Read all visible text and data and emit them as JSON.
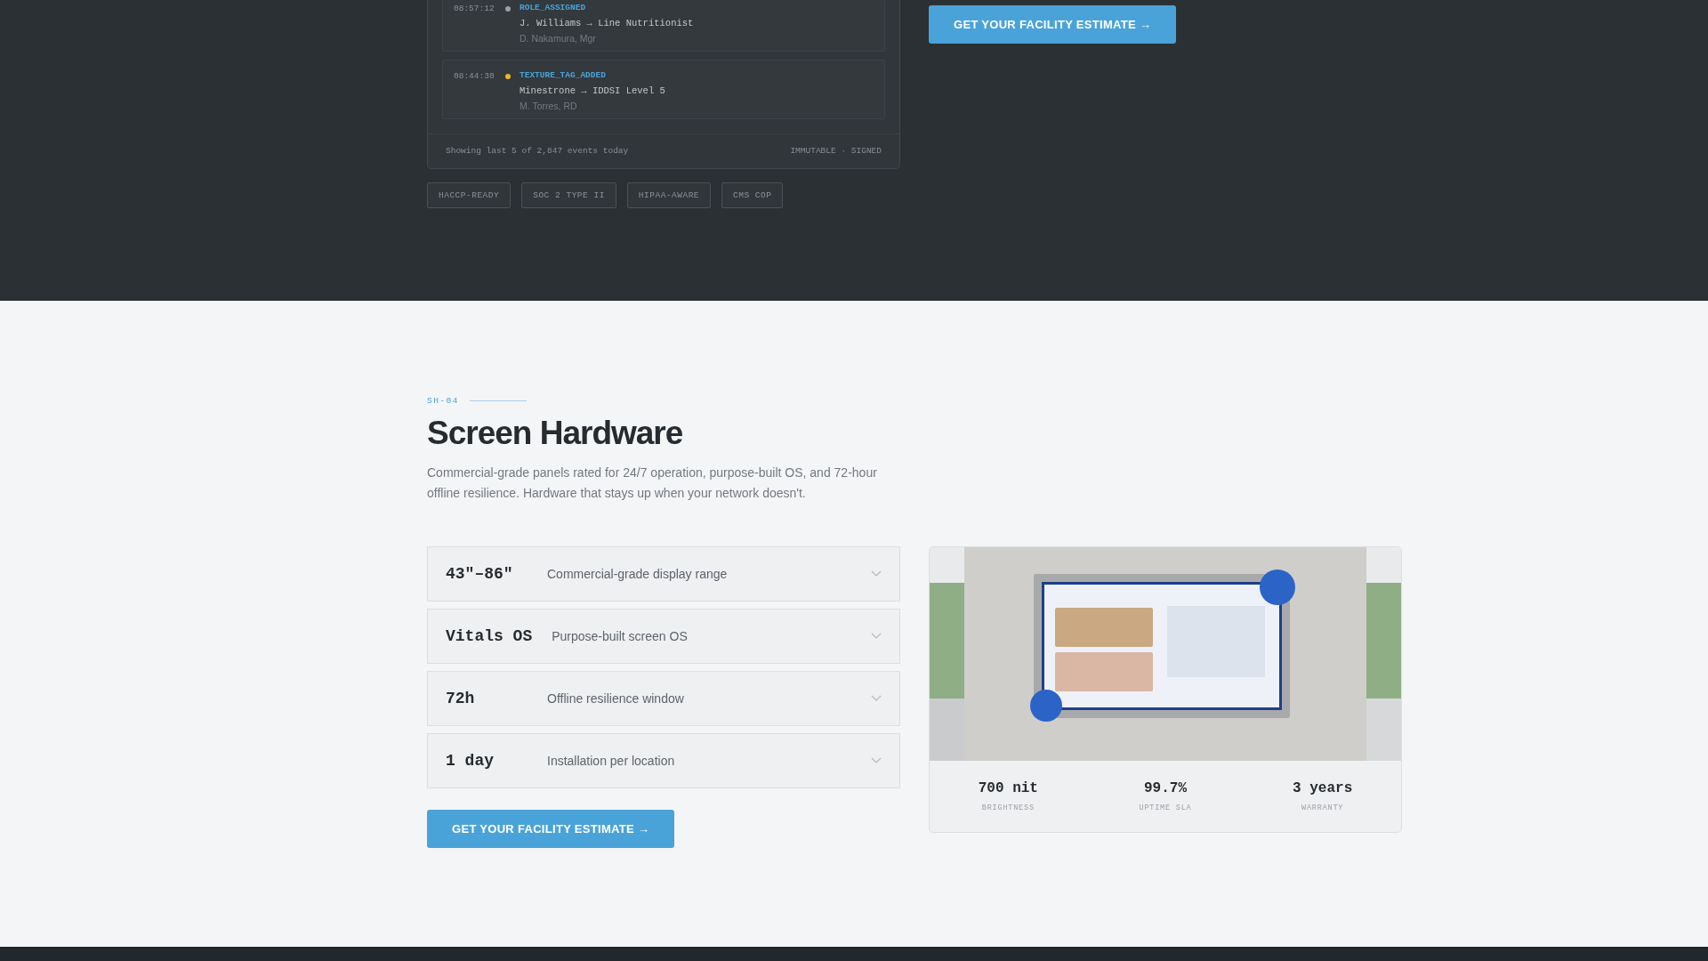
{
  "audit_log": {
    "events": [
      {
        "time": "08:57:12",
        "color": "#9aa0a6",
        "type": "ROLE_ASSIGNED",
        "detail": "J. Williams → Line Nutritionist",
        "actor": "D. Nakamura, Mgr"
      },
      {
        "time": "08:44:30",
        "color": "#f0b429",
        "type": "TEXTURE_TAG_ADDED",
        "detail": "Minestrone → IDDSI Level 5",
        "actor": "M. Torres, RD"
      }
    ],
    "footer_left": "Showing last 5 of 2,847 events today",
    "footer_right": "IMMUTABLE · SIGNED"
  },
  "badges": [
    "HACCP-READY",
    "SOC 2 TYPE II",
    "HIPAA-AWARE",
    "CMS COP"
  ],
  "top_cta": "GET YOUR FACILITY ESTIMATE →",
  "section": {
    "code": "SH-04",
    "title": "Screen Hardware",
    "description": "Commercial-grade panels rated for 24/7 operation, purpose-built OS, and 72-hour offline resilience. Hardware that stays up when your network doesn't.",
    "specs": [
      {
        "value": "43\"–86\"",
        "label": "Commercial-grade display range",
        "expanded": false
      },
      {
        "value": "Vitals OS",
        "label": "Purpose-built screen OS",
        "expanded": false
      },
      {
        "value": "72h",
        "label": "Offline resilience window",
        "expanded": false
      },
      {
        "value": "1 day",
        "label": "Installation per location",
        "expanded": false
      }
    ],
    "cta": "GET YOUR FACILITY ESTIMATE →",
    "hardware_card": {
      "stats": [
        {
          "value": "700 nit",
          "label": "BRIGHTNESS"
        },
        {
          "value": "99.7%",
          "label": "UPTIME SLA"
        },
        {
          "value": "3 years",
          "label": "WARRANTY"
        }
      ]
    }
  }
}
